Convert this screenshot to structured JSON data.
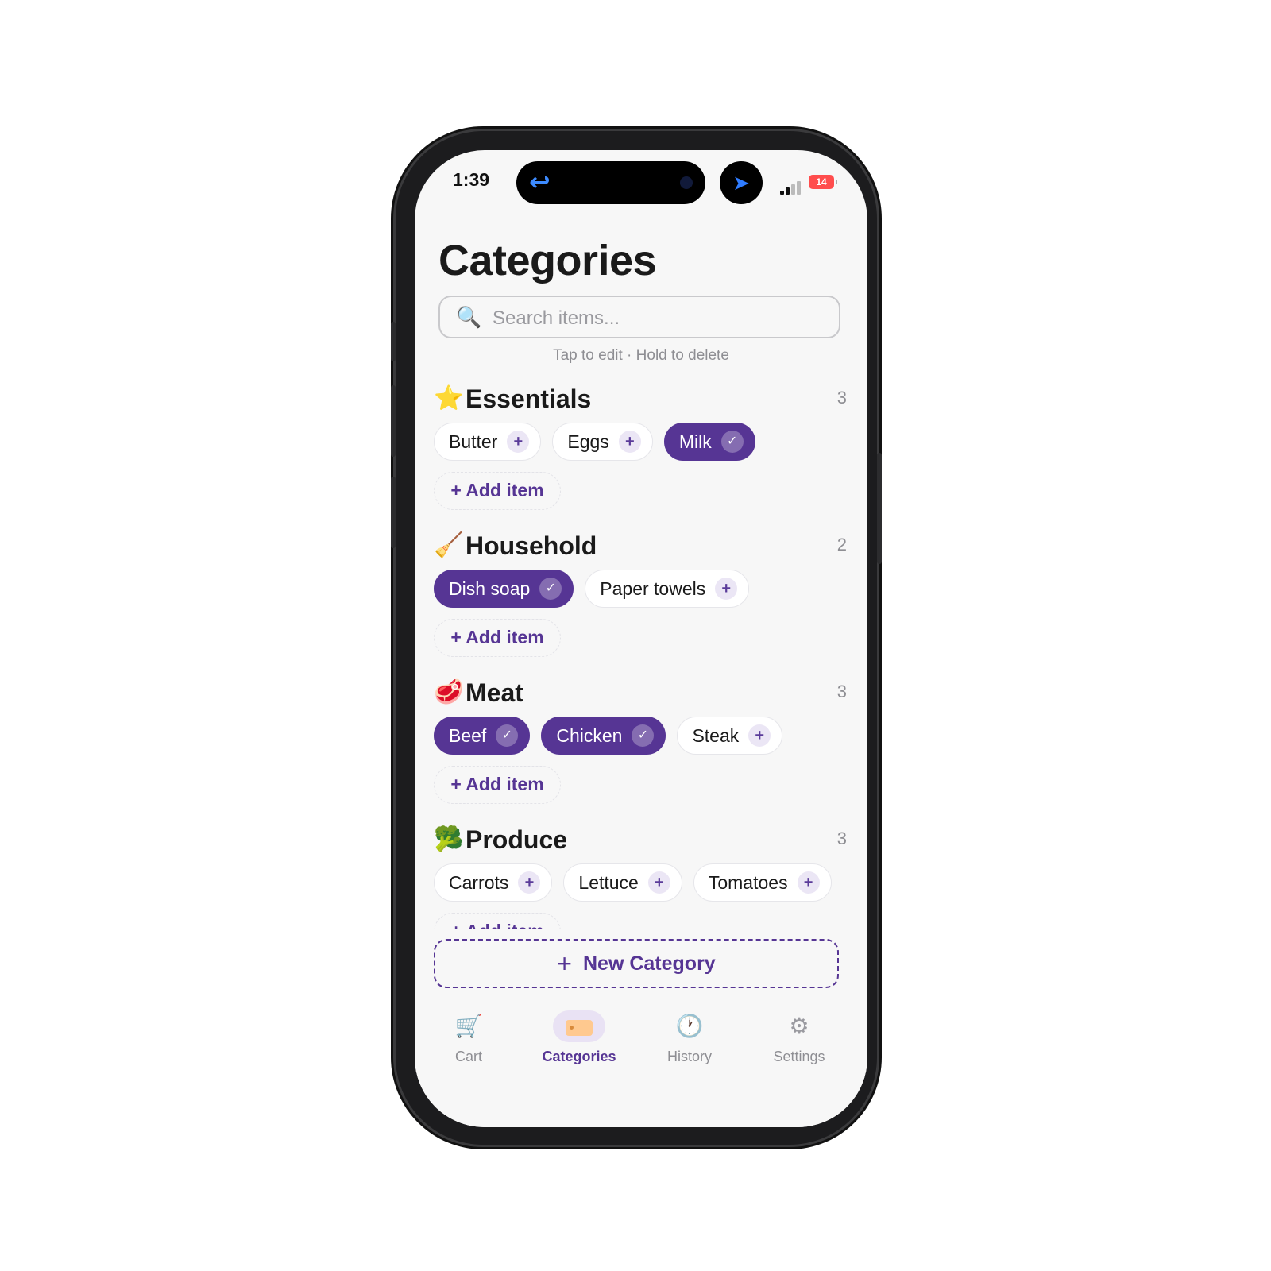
{
  "status_bar": {
    "time": "1:39",
    "back_glyph": "↩",
    "nav_glyph": "➤",
    "battery": "14"
  },
  "page": {
    "title": "Categories"
  },
  "search": {
    "placeholder": "Search items...",
    "icon": "magnifier-icon"
  },
  "hint": "Tap to edit · Hold to delete",
  "sections": [
    {
      "emoji": "⭐",
      "name": "Essentials",
      "count": "3",
      "items": [
        {
          "label": "Butter",
          "checked": false
        },
        {
          "label": "Eggs",
          "checked": false
        },
        {
          "label": "Milk",
          "checked": true
        }
      ],
      "add_label": "+ Add item"
    },
    {
      "emoji": "🧹",
      "name": "Household",
      "count": "2",
      "items": [
        {
          "label": "Dish soap",
          "checked": true
        },
        {
          "label": "Paper towels",
          "checked": false
        }
      ],
      "add_label": "+ Add item"
    },
    {
      "emoji": "🥩",
      "name": "Meat",
      "count": "3",
      "items": [
        {
          "label": "Beef",
          "checked": true
        },
        {
          "label": "Chicken",
          "checked": true
        },
        {
          "label": "Steak",
          "checked": false
        }
      ],
      "add_label": "+ Add item"
    },
    {
      "emoji": "🥦",
      "name": "Produce",
      "count": "3",
      "items": [
        {
          "label": "Carrots",
          "checked": false
        },
        {
          "label": "Lettuce",
          "checked": false
        },
        {
          "label": "Tomatoes",
          "checked": false
        }
      ],
      "add_label": "+ Add item"
    }
  ],
  "glyphs": {
    "plus": "+",
    "check": "✓"
  },
  "new_category": {
    "plus": "+",
    "label": "New Category"
  },
  "tabs": [
    {
      "label": "Cart",
      "icon": "cart-icon",
      "glyph": "🛒",
      "active": false
    },
    {
      "label": "Categories",
      "icon": "tag-icon",
      "glyph": "",
      "active": true
    },
    {
      "label": "History",
      "icon": "clock-icon",
      "glyph": "🕐",
      "active": false
    },
    {
      "label": "Settings",
      "icon": "gear-icon",
      "glyph": "⚙",
      "active": false
    }
  ],
  "colors": {
    "accent": "#563594",
    "accent_light": "#ebe6f5",
    "background": "#f7f7f7"
  }
}
